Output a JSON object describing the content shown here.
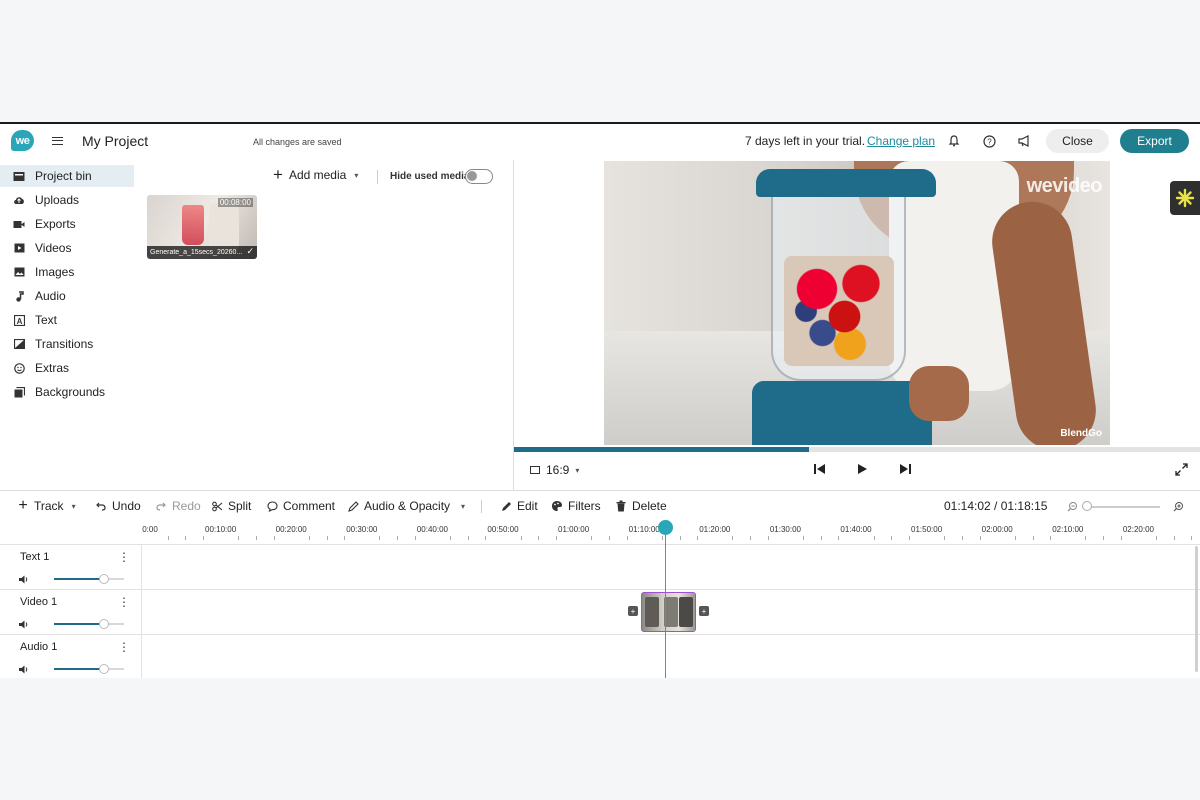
{
  "header": {
    "logo_text": "we",
    "project_title": "My Project",
    "save_status": "All changes are saved",
    "trial_text": "7 days left in your trial.",
    "change_plan": "Change plan",
    "close_label": "Close",
    "export_label": "Export"
  },
  "sidebar": {
    "items": [
      {
        "label": "Project bin",
        "icon": "folder-icon"
      },
      {
        "label": "Uploads",
        "icon": "cloud-upload-icon"
      },
      {
        "label": "Exports",
        "icon": "export-icon"
      },
      {
        "label": "Videos",
        "icon": "video-icon"
      },
      {
        "label": "Images",
        "icon": "image-icon"
      },
      {
        "label": "Audio",
        "icon": "music-note-icon"
      },
      {
        "label": "Text",
        "icon": "text-icon"
      },
      {
        "label": "Transitions",
        "icon": "transitions-icon"
      },
      {
        "label": "Extras",
        "icon": "smiley-icon"
      },
      {
        "label": "Backgrounds",
        "icon": "backgrounds-icon"
      }
    ]
  },
  "media": {
    "add_media": "Add media",
    "hide_used": "Hide used media",
    "clip": {
      "name": "Generate_a_15secs_20260...",
      "duration": "00:08:00"
    }
  },
  "preview": {
    "watermark": "wevideo",
    "watermark_small": "BlendGo",
    "aspect_ratio": "16:9",
    "progress_fraction": 0.43
  },
  "toolbar": {
    "track": "Track",
    "undo": "Undo",
    "redo": "Redo",
    "split": "Split",
    "comment": "Comment",
    "audio_opacity": "Audio & Opacity",
    "edit": "Edit",
    "filters": "Filters",
    "delete": "Delete",
    "timecode": "01:14:02 / 01:18:15"
  },
  "ruler": {
    "labels": [
      "0:00",
      "00:10:00",
      "00:20:00",
      "00:30:00",
      "00:40:00",
      "00:50:00",
      "01:00:00",
      "01:10:00",
      "01:20:00",
      "01:30:00",
      "01:40:00",
      "01:50:00",
      "02:00:00",
      "02:10:00",
      "02:20:00"
    ]
  },
  "tracks": [
    {
      "name": "Text 1",
      "volume": 0.72
    },
    {
      "name": "Video 1",
      "volume": 0.72
    },
    {
      "name": "Audio 1",
      "volume": 0.72
    }
  ],
  "colors": {
    "accent": "#2aa6b9",
    "export_button": "#1f7f8f",
    "clip_border": "#a24fd6"
  }
}
